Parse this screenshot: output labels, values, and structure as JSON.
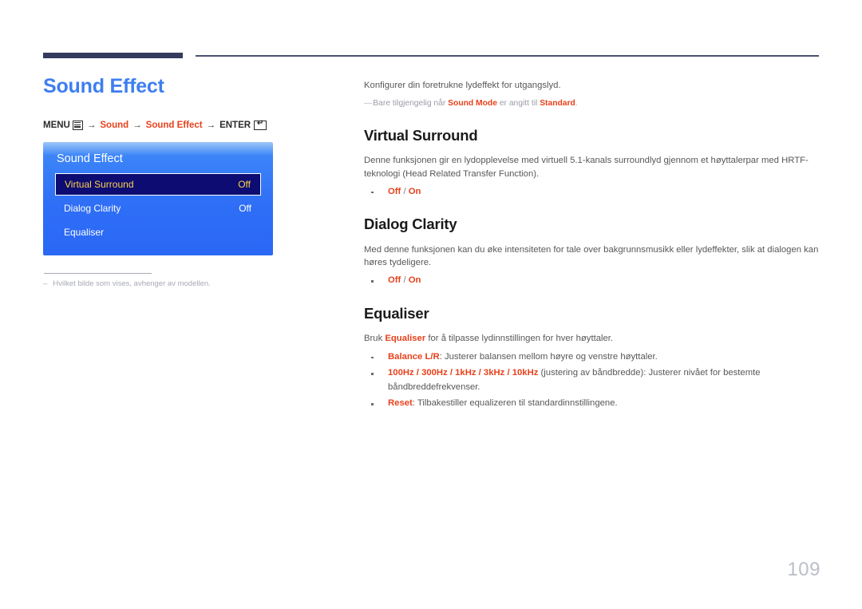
{
  "page": {
    "number": "109"
  },
  "left": {
    "title": "Sound Effect",
    "menu_path": {
      "menu_label": "MENU",
      "menu_icon": "menu-lines-icon",
      "arrow": "→",
      "step1": "Sound",
      "step2": "Sound Effect",
      "enter_label": "ENTER",
      "enter_icon": "enter-arrow-icon"
    },
    "osd": {
      "title": "Sound Effect",
      "rows": [
        {
          "label": "Virtual Surround",
          "value": "Off",
          "selected": true
        },
        {
          "label": "Dialog Clarity",
          "value": "Off",
          "selected": false
        },
        {
          "label": "Equaliser",
          "value": "",
          "selected": false
        }
      ]
    },
    "footnote": {
      "dash": "‒",
      "text": "Hvilket bilde som vises, avhenger av modellen."
    }
  },
  "right": {
    "intro": "Konfigurer din foretrukne lydeffekt for utgangslyd.",
    "note": {
      "dash": "—",
      "part1": "Bare tilgjengelig når ",
      "bold1": "Sound Mode",
      "part2": " er angitt til ",
      "bold2": "Standard",
      "part3": "."
    },
    "sections": [
      {
        "heading": "Virtual Surround",
        "body": "Denne funksjonen gir en lydopplevelse med virtuell 5.1-kanals surroundlyd gjennom et høyttalerpar med HRTF-teknologi (Head Related Transfer Function).",
        "options": {
          "opt1": "Off",
          "sep": " / ",
          "opt2": "On"
        }
      },
      {
        "heading": "Dialog Clarity",
        "body": "Med denne funksjonen kan du øke intensiteten for tale over bakgrunnsmusikk eller lydeffekter, slik at dialogen kan høres tydeligere.",
        "options": {
          "opt1": "Off",
          "sep": " / ",
          "opt2": "On"
        }
      },
      {
        "heading": "Equaliser",
        "lead_pre": "Bruk ",
        "lead_bold": "Equaliser",
        "lead_post": " for å tilpasse lydinnstillingen for hver høyttaler.",
        "bullets": [
          {
            "bold": "Balance L/R",
            "text": ": Justerer balansen mellom høyre og venstre høyttaler."
          },
          {
            "bold": "100Hz / 300Hz / 1kHz / 3kHz / 10kHz",
            "text": " (justering av båndbredde): Justerer nivået for bestemte båndbreddefrekvenser."
          },
          {
            "bold": "Reset",
            "text": ": Tilbakestiller equalizeren til standardinnstillingene."
          }
        ]
      }
    ]
  },
  "colors": {
    "accent_blue": "#3e7ef0",
    "accent_red": "#e8411b",
    "rule_navy": "#353b5e",
    "osd_blue": "#2f6ef6",
    "osd_selected": "#0c0c73",
    "osd_selected_text": "#ffd24a"
  }
}
